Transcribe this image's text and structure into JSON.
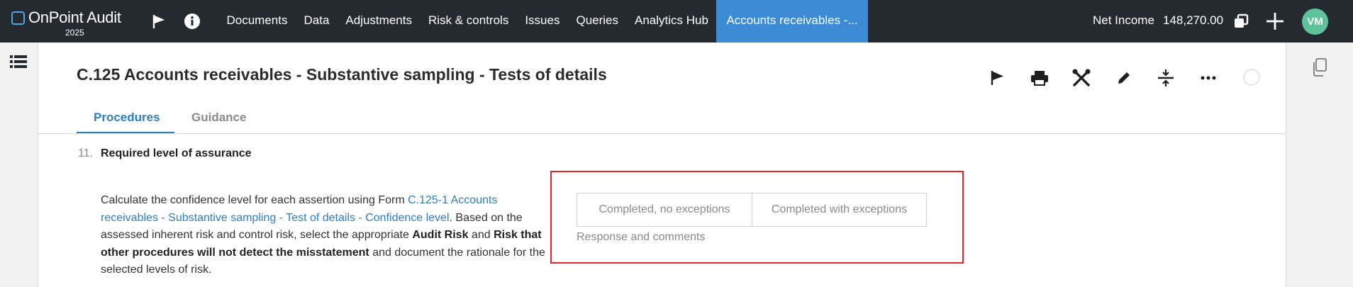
{
  "app": {
    "name": "OnPoint Audit",
    "year": "2025",
    "brand_color": "#3d8bd4"
  },
  "topbar": {
    "flag_icon": "flag-icon",
    "info_icon": "info-icon",
    "nav": [
      {
        "label": "Documents",
        "active": false
      },
      {
        "label": "Data",
        "active": false
      },
      {
        "label": "Adjustments",
        "active": false
      },
      {
        "label": "Risk & controls",
        "active": false
      },
      {
        "label": "Issues",
        "active": false
      },
      {
        "label": "Queries",
        "active": false
      },
      {
        "label": "Analytics Hub",
        "active": false
      },
      {
        "label": "Accounts receivables -...",
        "active": true
      }
    ],
    "net_income_label": "Net Income",
    "net_income_value": "148,270.00",
    "avatar_initials": "VM",
    "avatar_color": "#5ec29a"
  },
  "page": {
    "title": "C.125 Accounts receivables - Substantive sampling - Tests of details",
    "toolbar_icons": [
      "flag-icon",
      "print-icon",
      "tools-icon",
      "edit-icon",
      "collapse-icon",
      "more-icon"
    ],
    "tabs": [
      {
        "label": "Procedures",
        "active": true
      },
      {
        "label": "Guidance",
        "active": false
      }
    ]
  },
  "procedure": {
    "number": "11.",
    "title": "Required level of assurance",
    "desc_intro": "Calculate the confidence level for each assertion using Form ",
    "desc_link": "C.125-1 Accounts receivables - Substantive sampling - Test of details - Confidence level",
    "desc_mid1": ". Based on the assessed inherent risk and control risk, select the appropriate ",
    "desc_bold1": "Audit Risk",
    "desc_mid2": " and ",
    "desc_bold2": "Risk that other procedures will not detect the misstatement",
    "desc_end": " and document the rationale for the selected levels of risk.",
    "option_no_exceptions": "Completed, no exceptions",
    "option_with_exceptions": "Completed with exceptions",
    "response_label": "Response and comments",
    "highlight_color": "#e0262b"
  }
}
